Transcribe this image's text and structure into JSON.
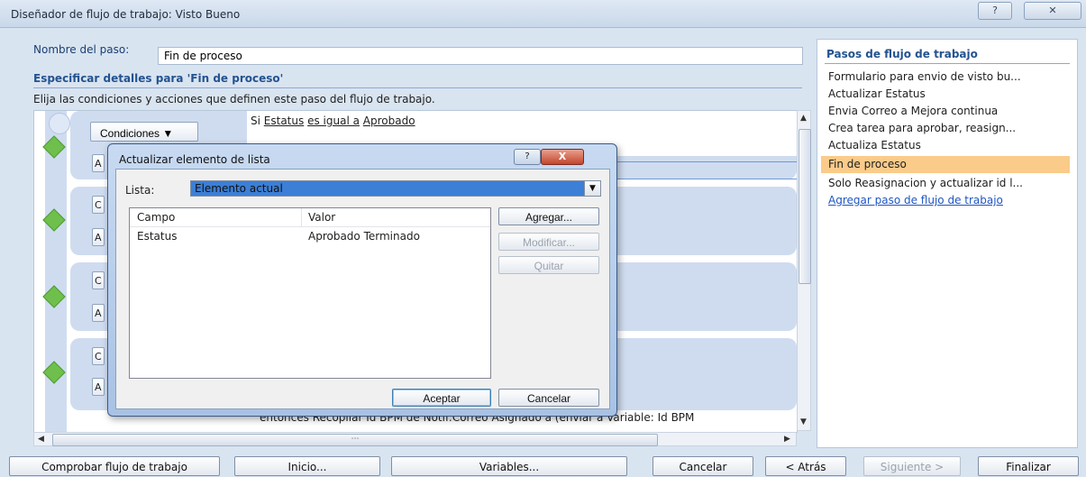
{
  "window": {
    "title": "Diseñador de flujo de trabajo: Visto Bueno",
    "help_label": "?",
    "close_label": "✕"
  },
  "main": {
    "step_name_label": "Nombre del paso:",
    "step_name_value": "Fin de proceso",
    "section_title": "Especificar detalles para 'Fin de proceso'",
    "instructions": "Elija las condiciones y acciones que definen este paso del flujo de trabajo.",
    "conditions_button": "Condiciones",
    "rule": {
      "prefix": "Si",
      "field": "Estatus",
      "operator": "es igual a",
      "value": "Aprobado"
    },
    "bottom_rule": "entonces Recopilar Id BPM de Notif:Correo Asignado a (enviar a Variable: Id BPM",
    "stub_letters": [
      "A",
      "C",
      "A",
      "C",
      "A",
      "C",
      "A"
    ]
  },
  "right_panel": {
    "title": "Pasos de flujo de trabajo",
    "steps": [
      "Formulario para envio de visto bu...",
      "Actualizar Estatus",
      "Envia Correo a Mejora continua",
      "Crea tarea para aprobar, reasign...",
      "Actualiza Estatus",
      "Fin de proceso",
      "Solo Reasignacion y actualizar id l..."
    ],
    "selected_index": 5,
    "add_step_link": "Agregar paso de flujo de trabajo"
  },
  "bottom_bar": {
    "check": "Comprobar flujo de trabajo",
    "start": "Inicio...",
    "variables": "Variables...",
    "cancel": "Cancelar",
    "back": "< Atrás",
    "next": "Siguiente >",
    "finish": "Finalizar"
  },
  "dialog": {
    "title": "Actualizar elemento de lista",
    "help_label": "?",
    "close_label": "X",
    "list_label": "Lista:",
    "list_value": "Elemento actual",
    "columns": [
      "Campo",
      "Valor"
    ],
    "rows": [
      [
        "Estatus",
        "Aprobado Terminado"
      ]
    ],
    "add_button": "Agregar...",
    "modify_button": "Modificar...",
    "remove_button": "Quitar",
    "ok_button": "Aceptar",
    "cancel_button": "Cancelar"
  }
}
